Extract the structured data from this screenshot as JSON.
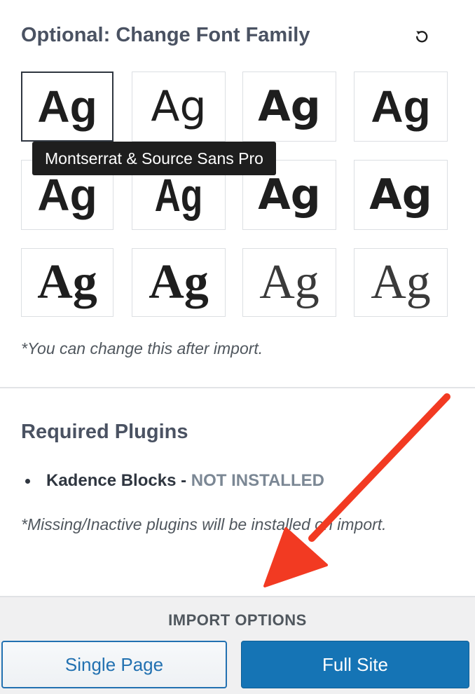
{
  "font_section": {
    "title": "Optional: Change Font Family",
    "reset_icon": "reset-icon",
    "tile_glyph": "Ag",
    "tooltip": "Montserrat & Source Sans Pro",
    "note": "*You can change this after import."
  },
  "plugins_section": {
    "title": "Required Plugins",
    "plugins": [
      {
        "name": "Kadence Blocks",
        "separator": " - ",
        "status": "NOT INSTALLED"
      }
    ],
    "note": "*Missing/Inactive plugins will be installed on import."
  },
  "import_options": {
    "title": "IMPORT OPTIONS",
    "single_page_label": "Single Page",
    "full_site_label": "Full Site"
  },
  "colors": {
    "accent_blue": "#1574b5",
    "annotation_red": "#f23a22"
  }
}
